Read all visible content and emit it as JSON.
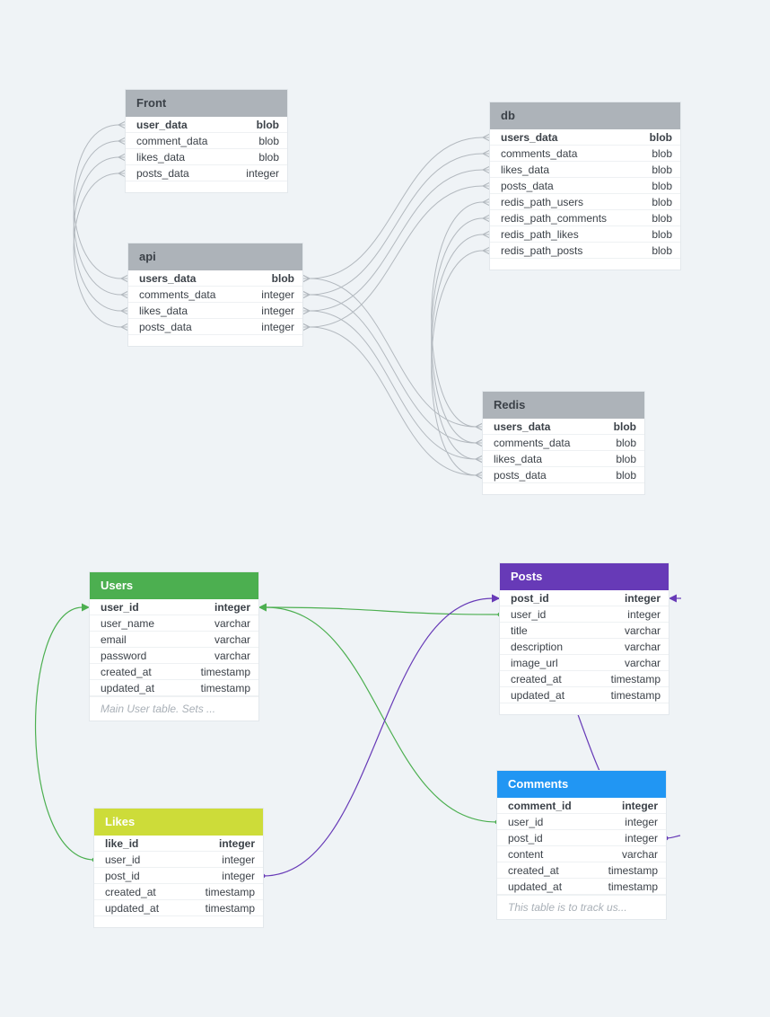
{
  "colors": {
    "canvas": "#eff3f6",
    "gray_header": "#adb3b9",
    "users_header": "#4caf50",
    "posts_header": "#673ab7",
    "comments_header": "#2196f3",
    "likes_header": "#cddc39",
    "gray_link": "#b3b9bf",
    "green_link": "#4caf50",
    "purple_link": "#673ab7"
  },
  "tables": [
    {
      "id": "front",
      "name": "Front",
      "header_color": "#adb3b9",
      "light_text": false,
      "columns": [
        {
          "name": "user_data",
          "type": "blob",
          "pk": true
        },
        {
          "name": "comment_data",
          "type": "blob",
          "pk": false
        },
        {
          "name": "likes_data",
          "type": "blob",
          "pk": false
        },
        {
          "name": "posts_data",
          "type": "integer",
          "pk": false
        }
      ],
      "note": ""
    },
    {
      "id": "api",
      "name": "api",
      "header_color": "#adb3b9",
      "light_text": false,
      "columns": [
        {
          "name": "users_data",
          "type": "blob",
          "pk": true
        },
        {
          "name": "comments_data",
          "type": "integer",
          "pk": false
        },
        {
          "name": "likes_data",
          "type": "integer",
          "pk": false
        },
        {
          "name": "posts_data",
          "type": "integer",
          "pk": false
        }
      ],
      "note": ""
    },
    {
      "id": "db",
      "name": "db",
      "header_color": "#adb3b9",
      "light_text": false,
      "columns": [
        {
          "name": "users_data",
          "type": "blob",
          "pk": true
        },
        {
          "name": "comments_data",
          "type": "blob",
          "pk": false
        },
        {
          "name": "likes_data",
          "type": "blob",
          "pk": false
        },
        {
          "name": "posts_data",
          "type": "blob",
          "pk": false
        },
        {
          "name": "redis_path_users",
          "type": "blob",
          "pk": false
        },
        {
          "name": "redis_path_comments",
          "type": "blob",
          "pk": false
        },
        {
          "name": "redis_path_likes",
          "type": "blob",
          "pk": false
        },
        {
          "name": "redis_path_posts",
          "type": "blob",
          "pk": false
        }
      ],
      "note": ""
    },
    {
      "id": "redis",
      "name": "Redis",
      "header_color": "#adb3b9",
      "light_text": false,
      "columns": [
        {
          "name": "users_data",
          "type": "blob",
          "pk": true
        },
        {
          "name": "comments_data",
          "type": "blob",
          "pk": false
        },
        {
          "name": "likes_data",
          "type": "blob",
          "pk": false
        },
        {
          "name": "posts_data",
          "type": "blob",
          "pk": false
        }
      ],
      "note": ""
    },
    {
      "id": "users",
      "name": "Users",
      "header_color": "#4caf50",
      "light_text": true,
      "columns": [
        {
          "name": "user_id",
          "type": "integer",
          "pk": true
        },
        {
          "name": "user_name",
          "type": "varchar",
          "pk": false
        },
        {
          "name": "email",
          "type": "varchar",
          "pk": false
        },
        {
          "name": "password",
          "type": "varchar",
          "pk": false
        },
        {
          "name": "created_at",
          "type": "timestamp",
          "pk": false
        },
        {
          "name": "updated_at",
          "type": "timestamp",
          "pk": false
        }
      ],
      "note": "Main User table. Sets ..."
    },
    {
      "id": "posts",
      "name": "Posts",
      "header_color": "#673ab7",
      "light_text": true,
      "columns": [
        {
          "name": "post_id",
          "type": "integer",
          "pk": true
        },
        {
          "name": "user_id",
          "type": "integer",
          "pk": false
        },
        {
          "name": "title",
          "type": "varchar",
          "pk": false
        },
        {
          "name": "description",
          "type": "varchar",
          "pk": false
        },
        {
          "name": "image_url",
          "type": "varchar",
          "pk": false
        },
        {
          "name": "created_at",
          "type": "timestamp",
          "pk": false
        },
        {
          "name": "updated_at",
          "type": "timestamp",
          "pk": false
        }
      ],
      "note": ""
    },
    {
      "id": "likes",
      "name": "Likes",
      "header_color": "#cddc39",
      "light_text": true,
      "columns": [
        {
          "name": "like_id",
          "type": "integer",
          "pk": true
        },
        {
          "name": "user_id",
          "type": "integer",
          "pk": false
        },
        {
          "name": "post_id",
          "type": "integer",
          "pk": false
        },
        {
          "name": "created_at",
          "type": "timestamp",
          "pk": false
        },
        {
          "name": "updated_at",
          "type": "timestamp",
          "pk": false
        }
      ],
      "note": ""
    },
    {
      "id": "comments",
      "name": "Comments",
      "header_color": "#2196f3",
      "light_text": true,
      "columns": [
        {
          "name": "comment_id",
          "type": "integer",
          "pk": true
        },
        {
          "name": "user_id",
          "type": "integer",
          "pk": false
        },
        {
          "name": "post_id",
          "type": "integer",
          "pk": false
        },
        {
          "name": "content",
          "type": "varchar",
          "pk": false
        },
        {
          "name": "created_at",
          "type": "timestamp",
          "pk": false
        },
        {
          "name": "updated_at",
          "type": "timestamp",
          "pk": false
        }
      ],
      "note": "This table is to track us..."
    }
  ],
  "relations": [
    {
      "from": "api.users_data",
      "to": "front.user_data",
      "color": "gray"
    },
    {
      "from": "api.comments_data",
      "to": "front.comment_data",
      "color": "gray"
    },
    {
      "from": "api.likes_data",
      "to": "front.likes_data",
      "color": "gray"
    },
    {
      "from": "api.posts_data",
      "to": "front.posts_data",
      "color": "gray"
    },
    {
      "from": "api.users_data",
      "to": "db.users_data",
      "color": "gray"
    },
    {
      "from": "api.comments_data",
      "to": "db.comments_data",
      "color": "gray"
    },
    {
      "from": "api.likes_data",
      "to": "db.likes_data",
      "color": "gray"
    },
    {
      "from": "api.posts_data",
      "to": "db.posts_data",
      "color": "gray"
    },
    {
      "from": "api.users_data",
      "to": "redis.users_data",
      "color": "gray"
    },
    {
      "from": "api.comments_data",
      "to": "redis.comments_data",
      "color": "gray"
    },
    {
      "from": "api.likes_data",
      "to": "redis.likes_data",
      "color": "gray"
    },
    {
      "from": "api.posts_data",
      "to": "redis.posts_data",
      "color": "gray"
    },
    {
      "from": "db.redis_path_users",
      "to": "redis.users_data",
      "color": "gray"
    },
    {
      "from": "db.redis_path_comments",
      "to": "redis.comments_data",
      "color": "gray"
    },
    {
      "from": "db.redis_path_likes",
      "to": "redis.likes_data",
      "color": "gray"
    },
    {
      "from": "db.redis_path_posts",
      "to": "redis.posts_data",
      "color": "gray"
    },
    {
      "from": "posts.user_id",
      "to": "users.user_id",
      "color": "green"
    },
    {
      "from": "comments.user_id",
      "to": "users.user_id",
      "color": "green"
    },
    {
      "from": "likes.user_id",
      "to": "users.user_id",
      "color": "green"
    },
    {
      "from": "likes.post_id",
      "to": "posts.post_id",
      "color": "purple"
    },
    {
      "from": "comments.post_id",
      "to": "posts.post_id",
      "color": "purple"
    }
  ]
}
